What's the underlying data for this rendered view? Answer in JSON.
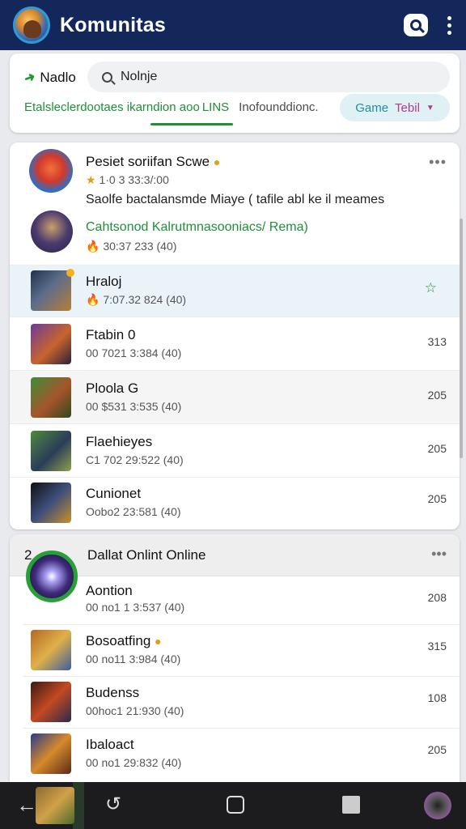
{
  "app": {
    "title": "Komunitas"
  },
  "filter": {
    "nadlo_label": "Nadlo",
    "search_value": "Nolnje",
    "tabs": [
      "Etalsleclerdootaes ikarndion aoo",
      "LINS",
      "Inofounddionc."
    ],
    "game_pill_a": "Game",
    "game_pill_b": "Tebil"
  },
  "list1": {
    "items": [
      {
        "name": "Pesiet soriifan Scwe",
        "meta": "1·0 3 33:3/:00",
        "extra": "Saolfe bactalansmde Miaye ( tafile abl ke il meames",
        "icon": "game-avatar-icon"
      },
      {
        "name": "Cahtsonod Kalrutmnasooniacs/ Rema)",
        "meta": "30:37 233 (40)",
        "icon": "warrior-avatar-icon"
      },
      {
        "name": "Hraloj",
        "meta": "7:07.32 824 (40)",
        "icon": "hero-thumb-icon"
      },
      {
        "name": "Ftabin 0",
        "meta": "00 7021 3:384 (40)",
        "count": "313",
        "icon": "mage-thumb-icon"
      },
      {
        "name": "Ploola G",
        "meta": "00 $531 3:535 (40)",
        "count": "205",
        "icon": "orc-thumb-icon"
      },
      {
        "name": "Flaehieyes",
        "meta": "C1 702 29:522 (40)",
        "count": "205",
        "icon": "knight-thumb-icon"
      },
      {
        "name": "Cunionet",
        "meta": "Oobo2 23:581 (40)",
        "count": "205",
        "icon": "rogue-thumb-icon"
      }
    ]
  },
  "list2": {
    "number": "2",
    "title": "Dallat Onlint Online",
    "items": [
      {
        "name": "Aontion",
        "meta": "00 no1 1 3:537 (40)",
        "count": "208",
        "icon": "vortex-thumb-icon"
      },
      {
        "name": "Bosoatfing",
        "meta": "00 no11 3:984 (40)",
        "count": "315",
        "icon": "dwarf-thumb-icon"
      },
      {
        "name": "Budenss",
        "meta": "00hoc1 21:930 (40)",
        "count": "108",
        "icon": "berserker-thumb-icon"
      },
      {
        "name": "Ibaloact",
        "meta": "00 no1 29:832 (40)",
        "count": "205",
        "icon": "paladin-thumb-icon"
      }
    ]
  },
  "colors": {
    "appbar": "#13275a",
    "accent_green": "#1f8f3a",
    "pill_bg": "#dff1f5"
  }
}
